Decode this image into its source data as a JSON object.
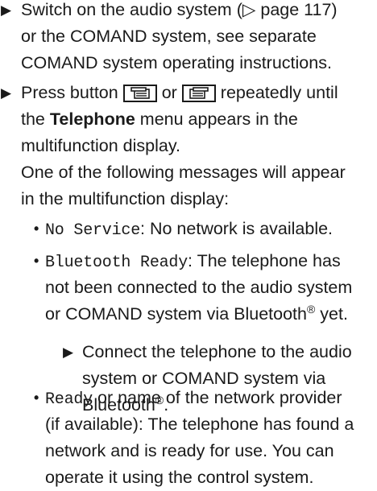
{
  "steps": [
    {
      "lines": [
        "Switch on the audio system (▷ page 117)",
        "or the COMAND system, see separate",
        "COMAND system operating instructions."
      ]
    },
    {
      "line1_a": "Press button",
      "line1_b": "or",
      "line1_c": "repeatedly until",
      "line2_a": "the",
      "line2_bold": "Telephone",
      "line2_b": "menu appears in the",
      "line3": "multifunction display.",
      "line4": "One of the following messages will appear",
      "line5": "in the multifunction display:"
    }
  ],
  "messages": [
    {
      "code": "No Service",
      "desc": ": No network is available."
    },
    {
      "code": "Bluetooth Ready",
      "desc_line1": ": The telephone has",
      "desc_line2": "not been connected to the audio system",
      "desc_line3": "or COMAND system via Bluetooth",
      "desc_line3_end": " yet.",
      "registered": "®",
      "substep_line1": "Connect the telephone to the audio",
      "substep_line2": "system or COMAND system via",
      "substep_line3": "Bluetooth",
      "substep_line3_end": "."
    },
    {
      "code": "Ready",
      "desc_line1": " or name of the network provider",
      "desc_line2": "(if available): The telephone has found a",
      "desc_line3": "network and is ready for use. You can",
      "desc_line4": "operate it using the control system."
    }
  ],
  "icons": {
    "step_arrow": "▶",
    "bullet": "•"
  }
}
